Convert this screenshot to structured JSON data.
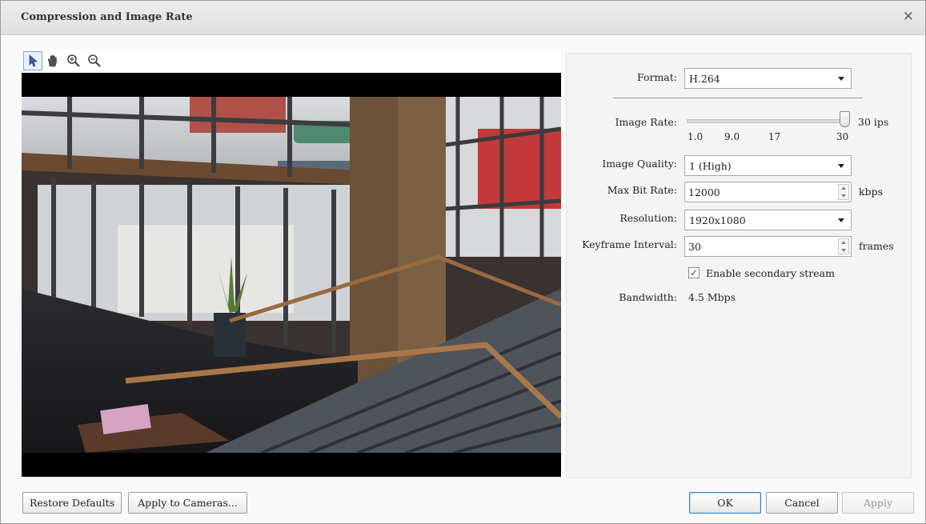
{
  "dialog": {
    "title": "Compression and Image Rate",
    "close_icon": "close-icon"
  },
  "toolbar": {
    "tools": [
      "pointer-icon",
      "hand-pan-icon",
      "zoom-in-icon",
      "zoom-out-icon"
    ]
  },
  "settings": {
    "format": {
      "label": "Format:",
      "value": "H.264"
    },
    "image_rate": {
      "label": "Image Rate:",
      "value_display": "30 ips",
      "ticks": [
        "1.0",
        "9.0",
        "17",
        "30"
      ],
      "min": 1.0,
      "max": 30,
      "value": 30
    },
    "image_quality": {
      "label": "Image Quality:",
      "value": "1 (High)"
    },
    "max_bit_rate": {
      "label": "Max Bit Rate:",
      "value": "12000",
      "unit": "kbps"
    },
    "resolution": {
      "label": "Resolution:",
      "value": "1920x1080"
    },
    "keyframe_interval": {
      "label": "Keyframe Interval:",
      "value": "30",
      "unit": "frames"
    },
    "secondary_stream": {
      "label": "Enable secondary stream",
      "checked": true
    },
    "bandwidth": {
      "label": "Bandwidth:",
      "value": "4.5 Mbps"
    }
  },
  "buttons": {
    "restore_defaults": "Restore Defaults",
    "apply_to_cameras": "Apply to Cameras...",
    "ok": "OK",
    "cancel": "Cancel",
    "apply": "Apply"
  }
}
